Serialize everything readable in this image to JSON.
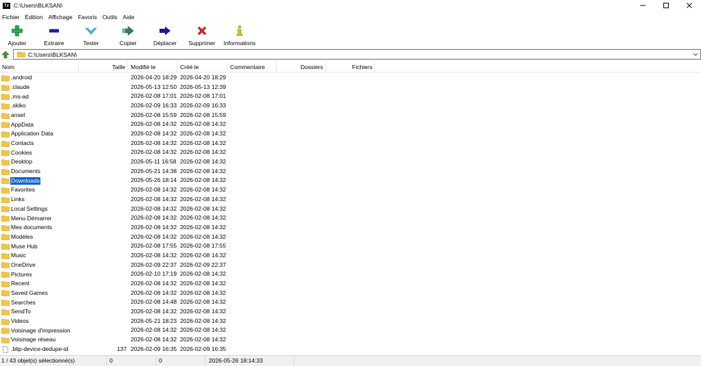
{
  "window": {
    "title": "C:\\Users\\BLKSAN\\",
    "app_icon_text": "7z"
  },
  "menu": [
    "Fichier",
    "Édition",
    "Affichage",
    "Favoris",
    "Outils",
    "Aide"
  ],
  "toolbar": [
    {
      "label": "Ajouter",
      "icon": "add-plus-icon",
      "color": "#22b14c"
    },
    {
      "label": "Extraire",
      "icon": "extract-minus-icon",
      "color": "#1a1aa8"
    },
    {
      "label": "Tester",
      "icon": "test-check-icon",
      "color": "#3cc7d6"
    },
    {
      "label": "Copier",
      "icon": "copy-arrow-icon",
      "color": "#2f7f6a"
    },
    {
      "label": "Déplacer",
      "icon": "move-arrow-icon",
      "color": "#1a1a8c"
    },
    {
      "label": "Supprimer",
      "icon": "delete-x-icon",
      "color": "#d42020"
    },
    {
      "label": "Informations",
      "icon": "info-i-icon",
      "color": "#e0c000"
    }
  ],
  "address": {
    "path": "C:\\Users\\BLKSAN\\"
  },
  "columns": {
    "name": "Nom",
    "size": "Taille",
    "modified": "Modifié le",
    "created": "Créé le",
    "comment": "Commentaire",
    "folders": "Dossiers",
    "files": "Fichiers"
  },
  "rows": [
    {
      "name": ".android",
      "size": "",
      "modified": "2026-04-20 18:29",
      "created": "2026-04-20 18:29",
      "type": "folder"
    },
    {
      "name": ".claude",
      "size": "",
      "modified": "2026-05-13 12:50",
      "created": "2026-05-13 12:39",
      "type": "folder"
    },
    {
      "name": ".ms-ad",
      "size": "",
      "modified": "2026-02-08 17:01",
      "created": "2026-02-08 17:01",
      "type": "folder"
    },
    {
      "name": ".skiko",
      "size": "",
      "modified": "2026-02-09 16:33",
      "created": "2026-02-09 16:33",
      "type": "folder"
    },
    {
      "name": "ansel",
      "size": "",
      "modified": "2026-02-08 15:59",
      "created": "2026-02-08 15:59",
      "type": "folder"
    },
    {
      "name": "AppData",
      "size": "",
      "modified": "2026-02-08 14:32",
      "created": "2026-02-08 14:32",
      "type": "folder"
    },
    {
      "name": "Application Data",
      "size": "",
      "modified": "2026-02-08 14:32",
      "created": "2026-02-08 14:32",
      "type": "folder"
    },
    {
      "name": "Contacts",
      "size": "",
      "modified": "2026-02-08 14:32",
      "created": "2026-02-08 14:32",
      "type": "folder"
    },
    {
      "name": "Cookies",
      "size": "",
      "modified": "2026-02-08 14:32",
      "created": "2026-02-08 14:32",
      "type": "folder"
    },
    {
      "name": "Desktop",
      "size": "",
      "modified": "2026-05-11 16:58",
      "created": "2026-02-08 14:32",
      "type": "folder"
    },
    {
      "name": "Documents",
      "size": "",
      "modified": "2026-05-21 14:38",
      "created": "2026-02-08 14:32",
      "type": "folder"
    },
    {
      "name": "Downloads",
      "size": "",
      "modified": "2026-05-26 18:14",
      "created": "2026-02-08 14:32",
      "type": "folder",
      "selected": true
    },
    {
      "name": "Favorites",
      "size": "",
      "modified": "2026-02-08 14:32",
      "created": "2026-02-08 14:32",
      "type": "folder"
    },
    {
      "name": "Links",
      "size": "",
      "modified": "2026-02-08 14:32",
      "created": "2026-02-08 14:32",
      "type": "folder"
    },
    {
      "name": "Local Settings",
      "size": "",
      "modified": "2026-02-08 14:32",
      "created": "2026-02-08 14:32",
      "type": "folder"
    },
    {
      "name": "Menu Démarrer",
      "size": "",
      "modified": "2026-02-08 14:32",
      "created": "2026-02-08 14:32",
      "type": "folder"
    },
    {
      "name": "Mes documents",
      "size": "",
      "modified": "2026-02-08 14:32",
      "created": "2026-02-08 14:32",
      "type": "folder"
    },
    {
      "name": "Modèles",
      "size": "",
      "modified": "2026-02-08 14:32",
      "created": "2026-02-08 14:32",
      "type": "folder"
    },
    {
      "name": "Muse Hub",
      "size": "",
      "modified": "2026-02-08 17:55",
      "created": "2026-02-08 17:55",
      "type": "folder"
    },
    {
      "name": "Music",
      "size": "",
      "modified": "2026-02-08 14:32",
      "created": "2026-02-08 14:32",
      "type": "folder"
    },
    {
      "name": "OneDrive",
      "size": "",
      "modified": "2026-02-09 22:37",
      "created": "2026-02-09 22:37",
      "type": "folder"
    },
    {
      "name": "Pictures",
      "size": "",
      "modified": "2026-02-10 17:19",
      "created": "2026-02-08 14:32",
      "type": "folder"
    },
    {
      "name": "Recent",
      "size": "",
      "modified": "2026-02-08 14:32",
      "created": "2026-02-08 14:32",
      "type": "folder"
    },
    {
      "name": "Saved Games",
      "size": "",
      "modified": "2026-02-08 14:32",
      "created": "2026-02-08 14:32",
      "type": "folder"
    },
    {
      "name": "Searches",
      "size": "",
      "modified": "2026-02-08 14:48",
      "created": "2026-02-08 14:32",
      "type": "folder"
    },
    {
      "name": "SendTo",
      "size": "",
      "modified": "2026-02-08 14:32",
      "created": "2026-02-08 14:32",
      "type": "folder"
    },
    {
      "name": "Videos",
      "size": "",
      "modified": "2026-05-21 18:23",
      "created": "2026-02-08 14:32",
      "type": "folder"
    },
    {
      "name": "Voisinage d'impression",
      "size": "",
      "modified": "2026-02-08 14:32",
      "created": "2026-02-08 14:32",
      "type": "folder"
    },
    {
      "name": "Voisinage réseau",
      "size": "",
      "modified": "2026-02-08 14:32",
      "created": "2026-02-08 14:32",
      "type": "folder"
    },
    {
      "name": ".blip-device-dedupe-id",
      "size": "137",
      "modified": "2026-02-09 16:35",
      "created": "2026-02-09 16:35",
      "type": "file"
    }
  ],
  "status": {
    "selection": "1 / 43 objet(s) sélectionné(s)",
    "size1": "0",
    "size2": "0",
    "datetime": "2026-05-26 18:14:33"
  },
  "colors": {
    "selection": "#0a64c8",
    "folder": "#f5c542"
  }
}
